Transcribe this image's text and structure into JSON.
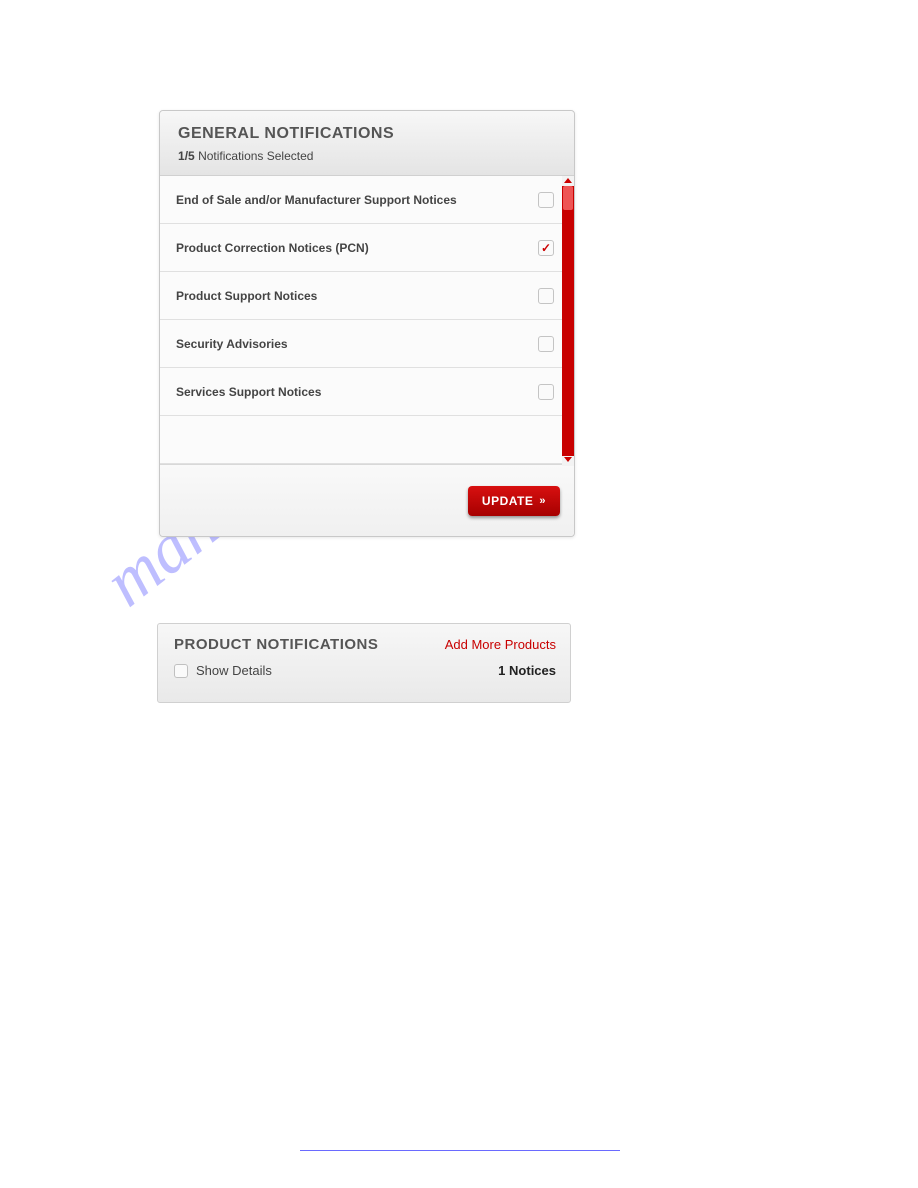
{
  "watermark": "manualshive.com",
  "general": {
    "title": "GENERAL NOTIFICATIONS",
    "counter_selected": "1",
    "counter_total": "5",
    "counter_suffix": "Notifications Selected",
    "items": [
      {
        "label": "End of Sale and/or Manufacturer Support Notices",
        "checked": false
      },
      {
        "label": "Product Correction Notices (PCN)",
        "checked": true
      },
      {
        "label": "Product Support Notices",
        "checked": false
      },
      {
        "label": "Security Advisories",
        "checked": false
      },
      {
        "label": "Services Support Notices",
        "checked": false
      }
    ],
    "update_label": "UPDATE"
  },
  "product": {
    "title": "PRODUCT NOTIFICATIONS",
    "add_link": "Add More Products",
    "show_details_label": "Show Details",
    "show_details_checked": false,
    "notices_count": "1",
    "notices_label": "Notices"
  }
}
